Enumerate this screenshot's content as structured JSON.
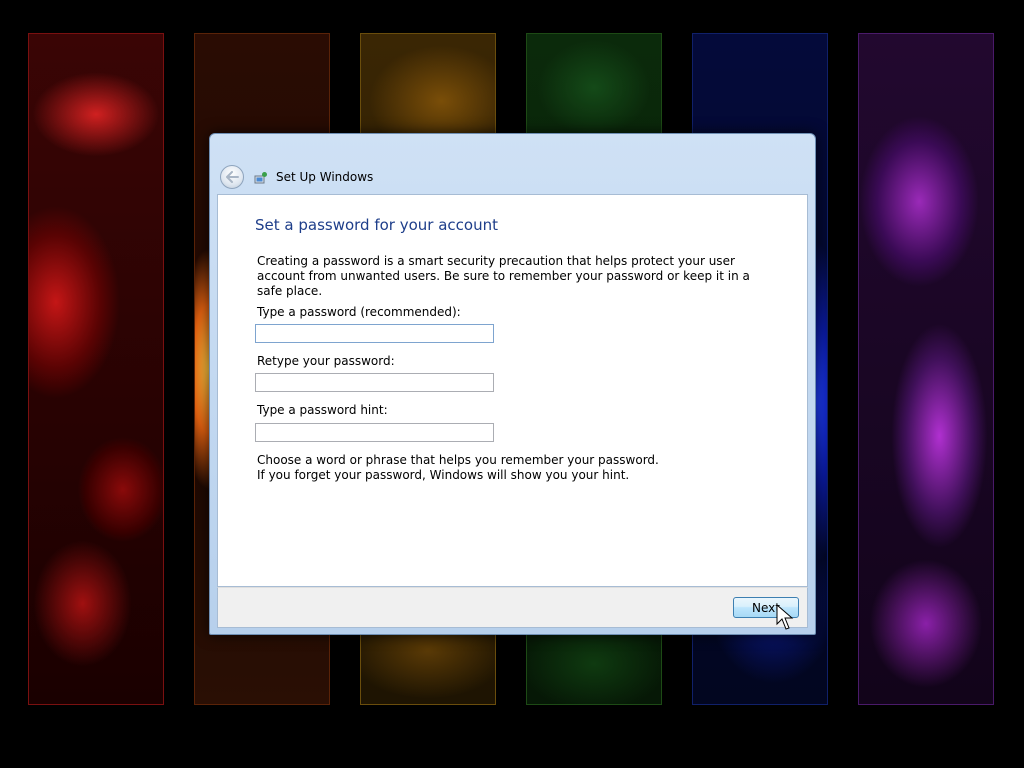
{
  "window": {
    "title": "Set Up Windows",
    "back_icon": "back-arrow-icon",
    "app_icon": "setup-icon"
  },
  "page": {
    "heading": "Set a password for your account",
    "description": "Creating a password is a smart security precaution that helps protect your user account from unwanted users. Be sure to remember your password or keep it in a safe place.",
    "password_label": "Type a password (recommended):",
    "password_value": "",
    "retype_label": "Retype your password:",
    "retype_value": "",
    "hint_label": "Type a password hint:",
    "hint_value": "",
    "hint_help_line1": "Choose a word or phrase that helps you remember your password.",
    "hint_help_line2": "If you forget your password, Windows will show you your hint."
  },
  "footer": {
    "next_label": "Next"
  },
  "colors": {
    "heading": "#1e3e8a",
    "frame": "#b7d0ec",
    "button_border": "#3c7fb1"
  }
}
